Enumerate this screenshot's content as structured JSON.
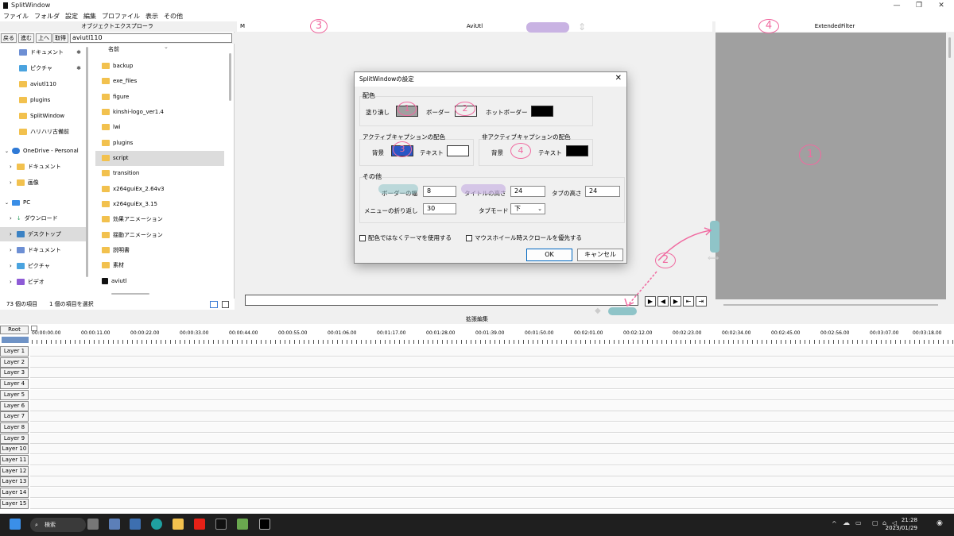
{
  "app": {
    "title": "SplitWindow"
  },
  "menu": [
    "ファイル",
    "フォルダ",
    "設定",
    "編集",
    "プロファイル",
    "表示",
    "その他"
  ],
  "explorer": {
    "title": "オブジェクトエクスプローラ",
    "nav_buttons": [
      "戻る",
      "進む",
      "上へ",
      "取得"
    ],
    "path": "aviutl110",
    "column_header": "名前",
    "tree": [
      {
        "label": "ドキュメント",
        "pinned": true
      },
      {
        "label": "ピクチャ",
        "pinned": true
      },
      {
        "label": "aviutl110"
      },
      {
        "label": "plugins"
      },
      {
        "label": "SplitWindow"
      },
      {
        "label": "ハリハリ古備前"
      },
      {
        "label": "OneDrive - Personal"
      },
      {
        "label": "ドキュメント"
      },
      {
        "label": "画像"
      },
      {
        "label": "PC"
      },
      {
        "label": "ダウンロード"
      },
      {
        "label": "デスクトップ"
      },
      {
        "label": "ドキュメント"
      },
      {
        "label": "ピクチャ"
      },
      {
        "label": "ビデオ"
      }
    ],
    "files": [
      "backup",
      "exe_files",
      "figure",
      "kinshi-logo_ver1.4",
      "lwi",
      "plugins",
      "script",
      "transition",
      "x264guiEx_2.64v3",
      "x264guiEx_3.15",
      "効果アニメーション",
      "揺動アニメーション",
      "説明書",
      "素材",
      "aviutl"
    ],
    "selected_file": "script",
    "status_count": "73 個の項目",
    "status_selected": "1 個の項目を選択"
  },
  "aviutl_pane": {
    "title": "AviUtl",
    "left_label": "M"
  },
  "extended_filter": {
    "title": "ExtendedFilter"
  },
  "dialog": {
    "title": "SplitWindowの設定",
    "close": "✕",
    "color_group": "配色",
    "fill_label": "塗り潰し",
    "border_label": "ボーダー",
    "hot_border_label": "ホットボーダー",
    "active_group": "アクティブキャプションの配色",
    "inactive_group": "非アクティブキャプションの配色",
    "bg_label": "背景",
    "text_label": "テキスト",
    "other_group": "その他",
    "border_width_label": "ボーダーの幅",
    "border_width": "8",
    "title_height_label": "タイトルの高さ",
    "title_height": "24",
    "tab_height_label": "タブの高さ",
    "tab_height": "24",
    "menu_wrap_label": "メニューの折り返し",
    "menu_wrap": "30",
    "tab_mode_label": "タブモード",
    "tab_mode": "下",
    "use_theme_label": "配色ではなくテーマを使用する",
    "wheel_scroll_label": "マウスホイール時スクロールを優先する",
    "ok": "OK",
    "cancel": "キャンセル"
  },
  "edit": {
    "title": "拡張編集",
    "root": "Root",
    "ticks": [
      "00:00:00.00",
      "00:00:11.00",
      "00:00:22.00",
      "00:00:33.00",
      "00:00:44.00",
      "00:00:55.00",
      "00:01:06.00",
      "00:01:17.00",
      "00:01:28.00",
      "00:01:39.00",
      "00:01:50.00",
      "00:02:01.00",
      "00:02:12.00",
      "00:02:23.00",
      "00:02:34.00",
      "00:02:45.00",
      "00:02:56.00",
      "00:03:07.00",
      "00:03:18.00"
    ],
    "layers": [
      "Layer 1",
      "Layer 2",
      "Layer 3",
      "Layer 4",
      "Layer 5",
      "Layer 6",
      "Layer 7",
      "Layer 8",
      "Layer 9",
      "Layer 10",
      "Layer 11",
      "Layer 12",
      "Layer 13",
      "Layer 14",
      "Layer 15"
    ]
  },
  "taskbar": {
    "search": "検索",
    "time": "21:28",
    "date": "2023/01/29"
  },
  "annotations": {
    "one": "1",
    "two": "2",
    "three": "3",
    "four": "4"
  },
  "colors": {
    "accent": "#0067c0",
    "annotation_pink": "#f06aa0",
    "annotation_teal": "#8fc4c8",
    "annotation_purple": "#c9b3e3"
  }
}
